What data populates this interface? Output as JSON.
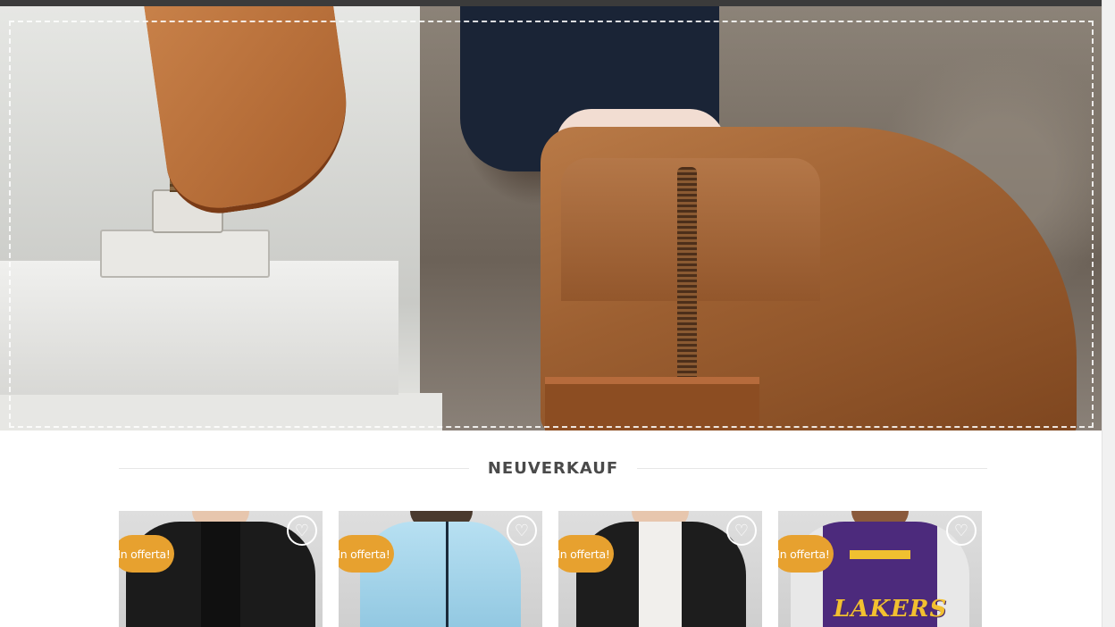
{
  "hero": {
    "alt_subject": "brown-ankle-boot"
  },
  "section": {
    "title": "NEUVERKAUF"
  },
  "products": [
    {
      "badge": "In offerta!",
      "wishlist_icon": "heart-icon",
      "color": "#1a1a1a"
    },
    {
      "badge": "In offerta!",
      "wishlist_icon": "heart-icon",
      "color": "#9fd0e8"
    },
    {
      "badge": "In offerta!",
      "wishlist_icon": "heart-icon",
      "color": "#1c1c1c"
    },
    {
      "badge": "In offerta!",
      "wishlist_icon": "heart-icon",
      "color": "#4a2a7a",
      "print": "LAKERS"
    }
  ],
  "colors": {
    "accent": "#e7a12f",
    "title": "#4a4a4a"
  }
}
